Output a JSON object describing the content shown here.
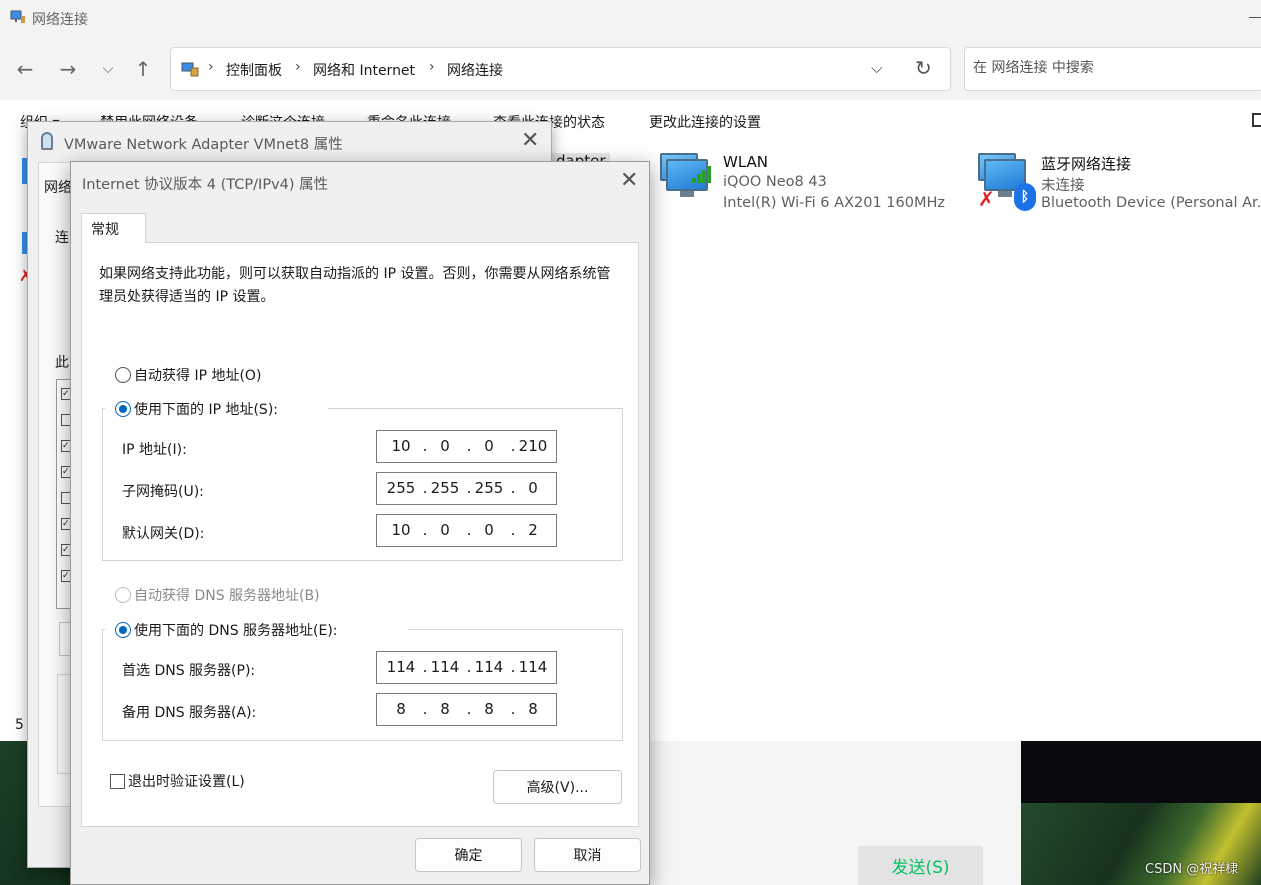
{
  "explorer": {
    "window_title": "网络连接",
    "breadcrumbs": [
      "控制面板",
      "网络和 Internet",
      "网络连接"
    ],
    "search_placeholder": "在 网络连接 中搜索",
    "commands": [
      "组织 ▾",
      "禁用此网络设备",
      "诊断这个连接",
      "重命名此连接",
      "查看此连接的状态",
      "更改此连接的设置"
    ],
    "partial_tile_name": "dapter",
    "partial_count": "5",
    "left_pane_chars": [
      "连"
    ],
    "connections": [
      {
        "name": "WLAN",
        "line1": "iQOO Neo8 43",
        "line2": "Intel(R) Wi-Fi 6 AX201 160MHz",
        "icon": "wifi-network-icon"
      },
      {
        "name": "蓝牙网络连接",
        "line1": "未连接",
        "line2": "Bluetooth Device (Personal Ar...",
        "icon": "bluetooth-network-icon"
      }
    ]
  },
  "vm_dialog": {
    "title": "VMware Network Adapter VMnet8 属性",
    "tab_partial": "网络",
    "label_partial_1": "连",
    "label_partial_2": "此"
  },
  "ipv4_dialog": {
    "title": "Internet 协议版本 4 (TCP/IPv4) 属性",
    "tab_general": "常规",
    "intro": "如果网络支持此功能，则可以获取自动指派的 IP 设置。否则，你需要从网络系统管理员处获得适当的 IP 设置。",
    "auto_ip_label": "自动获得 IP 地址(O)",
    "manual_ip_label": "使用下面的 IP 地址(S):",
    "ip_mode": "manual",
    "ip_address_label": "IP 地址(I):",
    "ip_address": [
      "10",
      "0",
      "0",
      "210"
    ],
    "subnet_label": "子网掩码(U):",
    "subnet_mask": [
      "255",
      "255",
      "255",
      "0"
    ],
    "gateway_label": "默认网关(D):",
    "gateway": [
      "10",
      "0",
      "0",
      "2"
    ],
    "auto_dns_label": "自动获得 DNS 服务器地址(B)",
    "manual_dns_label": "使用下面的 DNS 服务器地址(E):",
    "dns_mode": "manual",
    "preferred_dns_label": "首选 DNS 服务器(P):",
    "preferred_dns": [
      "114",
      "114",
      "114",
      "114"
    ],
    "alternate_dns_label": "备用 DNS 服务器(A):",
    "alternate_dns": [
      "8",
      "8",
      "8",
      "8"
    ],
    "validate_label": "退出时验证设置(L)",
    "validate_checked": false,
    "advanced_label": "高级(V)...",
    "ok_label": "确定",
    "cancel_label": "取消"
  },
  "background": {
    "send_label": "发送(S)",
    "send_color": "#07c160",
    "watermark": "CSDN @祝祥棣"
  }
}
